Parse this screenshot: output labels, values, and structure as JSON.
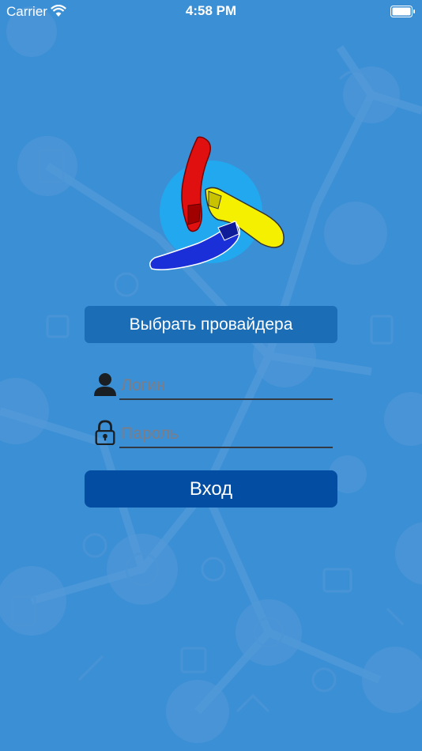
{
  "status_bar": {
    "carrier": "Carrier",
    "time": "4:58 PM"
  },
  "provider_button": {
    "label": "Выбрать провайдера"
  },
  "login_field": {
    "placeholder": "Логин",
    "value": ""
  },
  "password_field": {
    "placeholder": "Пароль",
    "value": ""
  },
  "submit_button": {
    "label": "Вход"
  },
  "colors": {
    "background": "#3b8fd5",
    "provider_button": "#1b6db6",
    "login_button": "#034ea2",
    "logo_circle": "#22a8ee",
    "logo_red": "#e01010",
    "logo_yellow": "#f4f000",
    "logo_blue": "#1a2fd8"
  },
  "icons": [
    "wifi-icon",
    "battery-icon",
    "user-icon",
    "lock-icon",
    "app-logo"
  ]
}
